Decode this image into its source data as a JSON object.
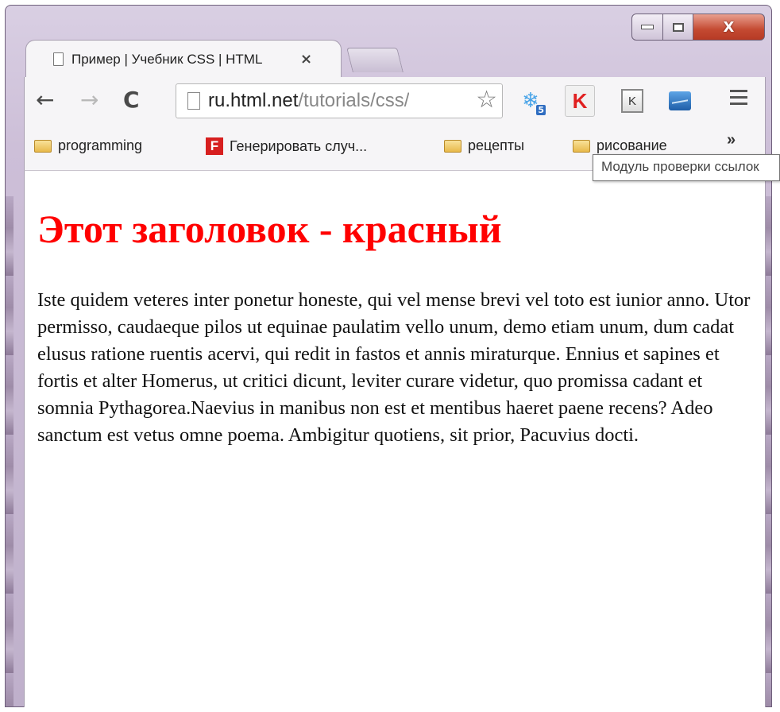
{
  "browser": {
    "tab_title": "Пример | Учебник CSS | HTML",
    "tab_close": "×",
    "url_host": "ru.html.net",
    "url_path": "/tutorials/css/",
    "extensions": {
      "snow_badge": "5",
      "kaspersky": "K",
      "kl": "K"
    },
    "bookmarks": [
      {
        "label": "programming",
        "icon": "folder-icon"
      },
      {
        "label": "Генерировать случ...",
        "icon": "f-favicon"
      },
      {
        "label": "рецепты",
        "icon": "folder-icon"
      },
      {
        "label": "рисование",
        "icon": "folder-icon"
      }
    ],
    "bookmarks_more": "»",
    "tooltip": "Модуль проверки ссылок"
  },
  "page": {
    "heading": "Этот заголовок - красный",
    "heading_color": "#ff0000",
    "paragraph": "Iste quidem veteres inter ponetur honeste, qui vel mense brevi vel toto est iunior anno. Utor permisso, caudaeque pilos ut equinae paulatim vello unum, demo etiam unum, dum cadat elusus ratione ruentis acervi, qui redit in fastos et annis miraturque. Ennius et sapines et fortis et alter Homerus, ut critici dicunt, leviter curare videtur, quo promissa cadant et somnia Pythagorea.Naevius in manibus non est et mentibus haeret paene recens? Adeo sanctum est vetus omne poema. Ambigitur quotiens, sit prior, Pacuvius docti."
  }
}
